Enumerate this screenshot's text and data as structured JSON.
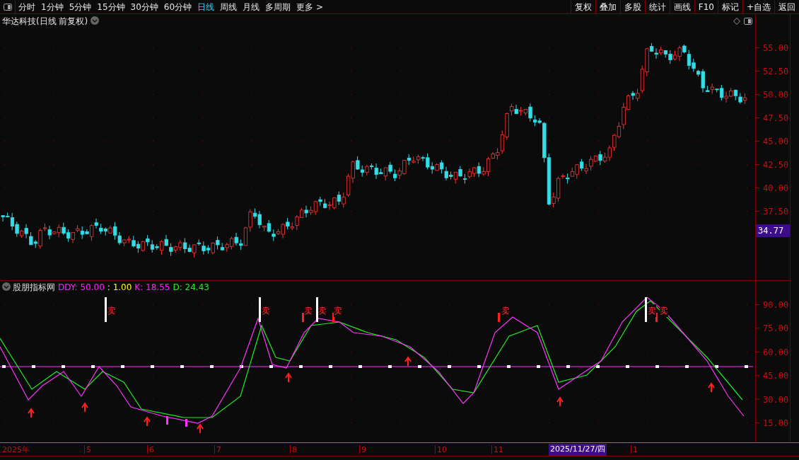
{
  "toolbar": {
    "periods": [
      {
        "label": "分时",
        "selected": false
      },
      {
        "label": "1分钟",
        "selected": false
      },
      {
        "label": "5分钟",
        "selected": false
      },
      {
        "label": "15分钟",
        "selected": false
      },
      {
        "label": "30分钟",
        "selected": false
      },
      {
        "label": "60分钟",
        "selected": false
      },
      {
        "label": "日线",
        "selected": true
      },
      {
        "label": "周线",
        "selected": false
      },
      {
        "label": "月线",
        "selected": false
      },
      {
        "label": "多周期",
        "selected": false
      },
      {
        "label": "更多 >",
        "selected": false
      }
    ],
    "actions": [
      "复权",
      "叠加",
      "多股",
      "统计",
      "画线",
      "F10",
      "标记",
      "+自选",
      "返回"
    ]
  },
  "price_chart": {
    "title": "华达科技(日线 前复权)",
    "axis_labels": [
      "55.00",
      "52.50",
      "50.00",
      "47.50",
      "45.00",
      "42.50",
      "40.00",
      "37.50"
    ],
    "current_price": "34.77"
  },
  "indicator": {
    "name": "股朋指标网",
    "values": [
      {
        "text": "DDY: 50.00",
        "color": "#ff22ff"
      },
      {
        "text": ": 1.00",
        "color": "#ffff00"
      },
      {
        "text": "K: 18.55",
        "color": "#ff22ff"
      },
      {
        "text": "D: 24.43",
        "color": "#22ee22"
      }
    ],
    "axis_labels": [
      "90.00",
      "75.00",
      "60.00",
      "45.00",
      "30.00",
      "15.00"
    ],
    "signals": [
      {
        "text": "卖"
      },
      {
        "text": "卖"
      },
      {
        "text": "卖"
      },
      {
        "text": "卖"
      },
      {
        "text": "卖"
      },
      {
        "text": "卖"
      },
      {
        "text": "卖"
      },
      {
        "text": "卖"
      }
    ]
  },
  "date_axis": {
    "labels": [
      "2025年",
      "5",
      "6",
      "7",
      "8",
      "9",
      "10",
      "11",
      "1"
    ],
    "cursor_date": "2025/11/27/四"
  }
}
